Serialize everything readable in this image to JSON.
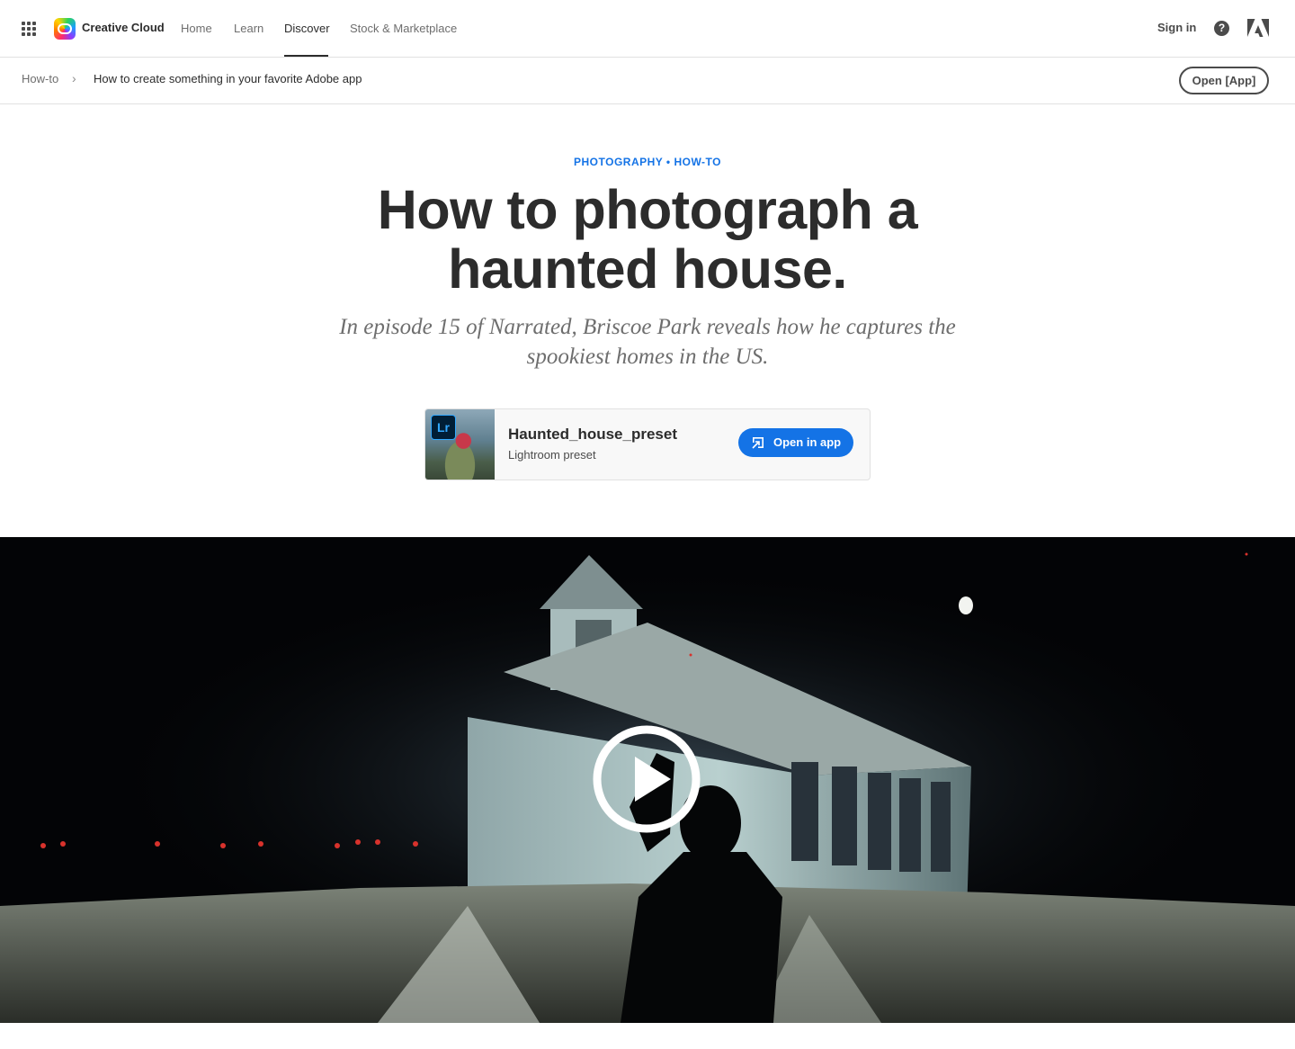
{
  "gnav": {
    "brand": "Creative Cloud",
    "links": {
      "home": "Home",
      "learn": "Learn",
      "discover": "Discover",
      "stock": "Stock & Marketplace"
    },
    "active": "Discover",
    "sign_in": "Sign in",
    "help_glyph": "?",
    "icons": {
      "apps": "apps-grid-icon",
      "logo": "creative-cloud-logo",
      "help": "help-icon",
      "adobe": "adobe-logo-icon"
    }
  },
  "subnav": {
    "breadcrumbs": [
      "How-to",
      "How to create something in your favorite Adobe app"
    ],
    "separator": "›",
    "open_app": "Open [App]"
  },
  "hero": {
    "eyebrow": "PHOTOGRAPHY • HOW-TO",
    "headline": "How to photograph a haunted house.",
    "subhead": "In episode 15 of Narrated, Briscoe Park reveals how he captures the spookiest homes in the US."
  },
  "preset_card": {
    "app_badge": "Lr",
    "title": "Haunted_house_preset",
    "subtitle": "Lightroom preset",
    "button": "Open in app"
  },
  "video": {
    "icon": "play-circle-icon"
  },
  "colors": {
    "accent": "#1473e6",
    "text": "#2c2c2c",
    "muted": "#6e6e6e",
    "lightroom": "#31a8ff"
  }
}
